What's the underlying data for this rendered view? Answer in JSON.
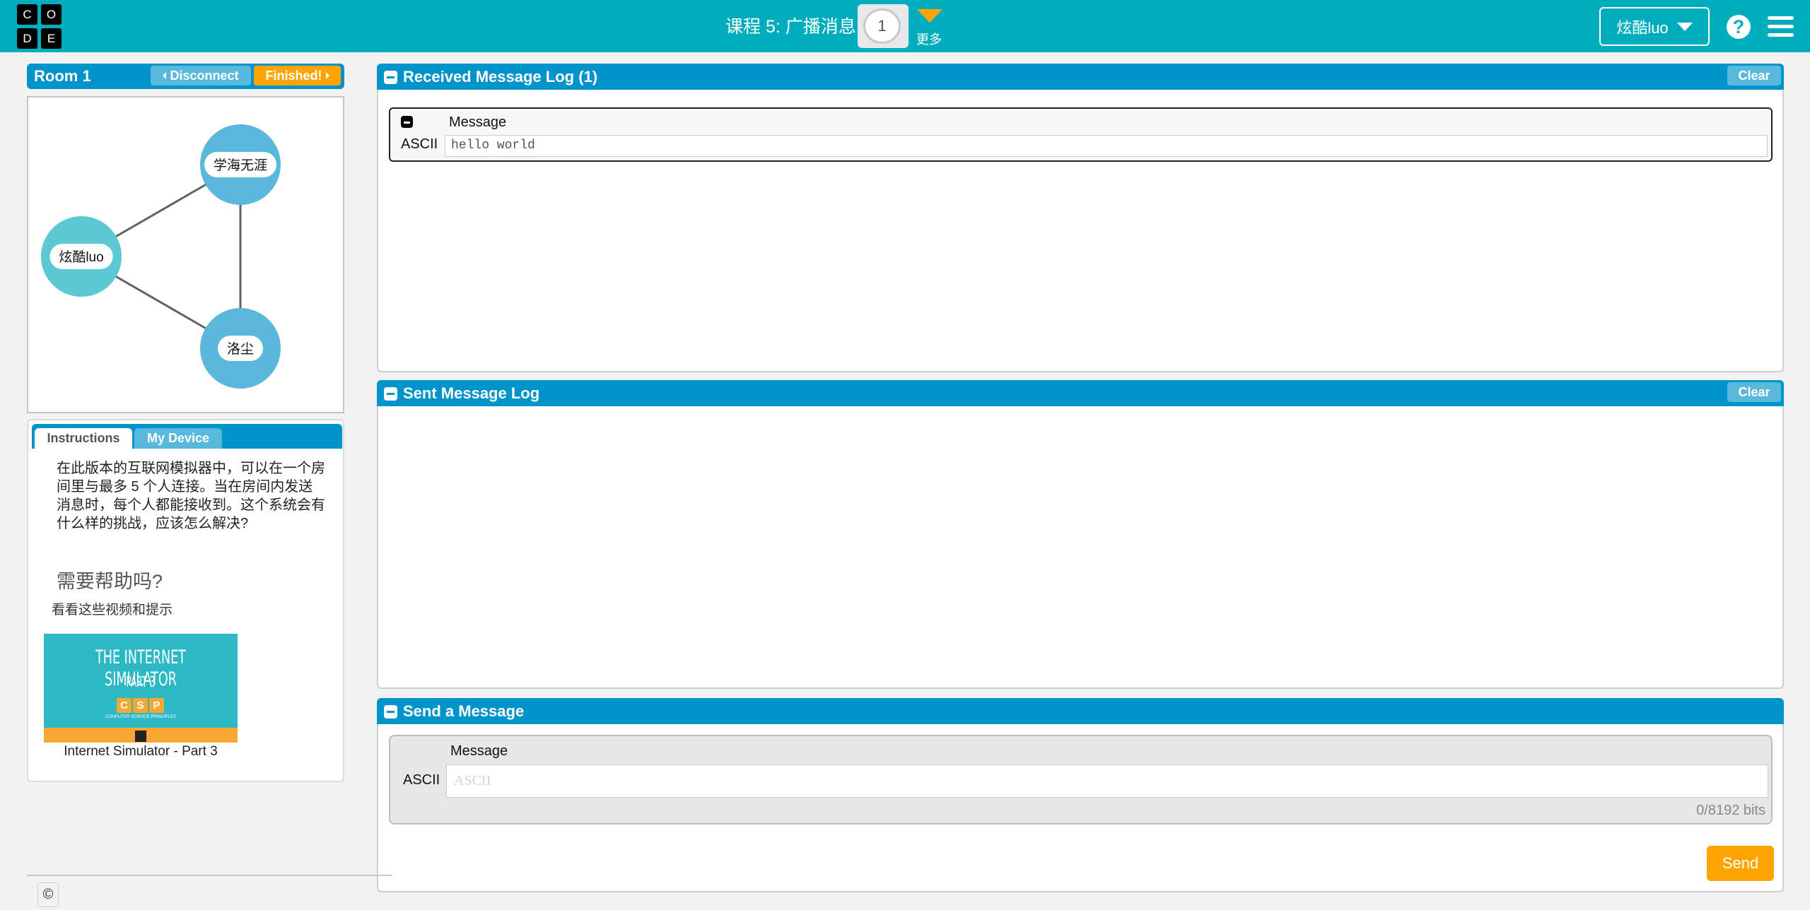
{
  "header": {
    "logo_letters": [
      "C",
      "O",
      "D",
      "E"
    ],
    "lesson_title": "课程 5: 广播消息",
    "level_number": "1",
    "more_label": "更多",
    "user_name": "炫酷luo",
    "help_icon": "question-circle-icon",
    "menu_icon": "hamburger-icon"
  },
  "room": {
    "title": "Room 1",
    "disconnect_label": "Disconnect",
    "finished_label": "Finished!"
  },
  "network": {
    "nodes": [
      {
        "name": "学海无涯",
        "color": "#5ab8dc"
      },
      {
        "name": "炫酷luo",
        "color": "#5bc8d4"
      },
      {
        "name": "洛尘",
        "color": "#5ab8dc"
      }
    ],
    "edges": [
      [
        "炫酷luo",
        "学海无涯"
      ],
      [
        "炫酷luo",
        "洛尘"
      ],
      [
        "学海无涯",
        "洛尘"
      ]
    ]
  },
  "instructions": {
    "tabs": [
      {
        "label": "Instructions",
        "active": true
      },
      {
        "label": "My Device",
        "active": false
      }
    ],
    "text": "在此版本的互联网模拟器中，可以在一个房间里与最多 5 个人连接。当在房间内发送消息时，每个人都能接收到。这个系统会有什么样的挑战，应该怎么解决?",
    "help_title": "需要帮助吗?",
    "help_subtitle": "看看这些视频和提示",
    "video": {
      "thumb_title": "THE INTERNET SIMULATOR",
      "thumb_part": "PART 3",
      "thumb_badge": [
        "C",
        "S",
        "P"
      ],
      "thumb_tagline": "COMPUTER SCIENCE PRINCIPLES",
      "caption": "Internet Simulator - Part 3"
    }
  },
  "received_log": {
    "title": "Received Message Log (1)",
    "clear_label": "Clear",
    "column_label": "Message",
    "messages": [
      {
        "encoding": "ASCII",
        "value": "hello world"
      }
    ]
  },
  "sent_log": {
    "title": "Sent Message Log",
    "clear_label": "Clear"
  },
  "send": {
    "title": "Send a Message",
    "column_label": "Message",
    "encoding": "ASCII",
    "input_value": "",
    "input_placeholder": "ASCII",
    "bit_count": "0/8192 bits",
    "send_label": "Send"
  },
  "footer": {
    "copyright_symbol": "©"
  },
  "colors": {
    "header_bg": "#00adbc",
    "panel_bar": "#0094ca",
    "secondary_button": "#59b9dc",
    "accent_orange": "#ffa400"
  }
}
